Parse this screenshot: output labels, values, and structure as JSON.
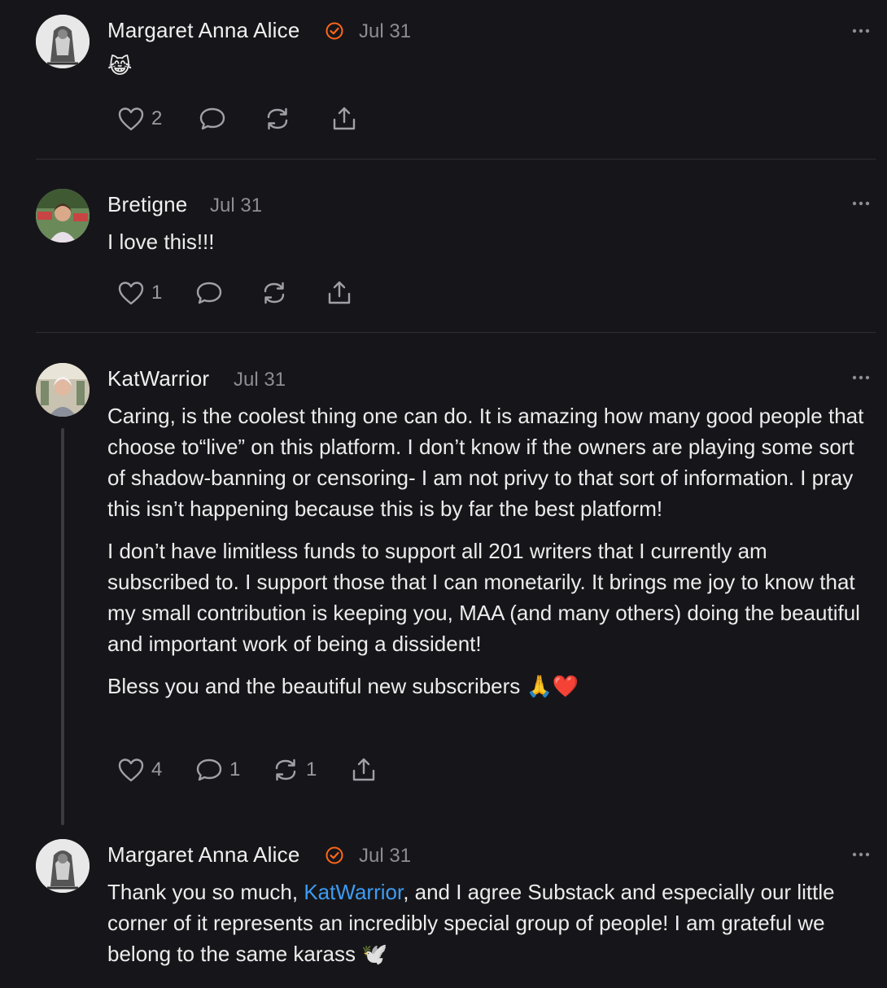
{
  "comments": [
    {
      "author": "Margaret Anna Alice",
      "verified": true,
      "date": "Jul 31",
      "text": "😹",
      "likes": "2",
      "replies": "",
      "restacks": ""
    },
    {
      "author": "Bretigne",
      "verified": false,
      "date": "Jul 31",
      "text": "I love this!!!",
      "likes": "1",
      "replies": "",
      "restacks": ""
    },
    {
      "author": "KatWarrior",
      "verified": false,
      "date": "Jul 31",
      "paragraphs": [
        "Caring, is the coolest thing one can do. It is amazing how many good people that choose to“live” on this platform. I don’t know if the owners are playing some sort of shadow-banning or censoring- I am not privy to that sort of information. I pray this isn’t happening because this is by far the best platform!",
        "I don’t have limitless funds to support all 201 writers that I currently am subscribed to. I support those that I can monetarily. It brings me joy to know that my small contribution is keeping you, MAA (and many others) doing the beautiful and important work of being a dissident!",
        "Bless you and the beautiful new subscribers 🙏❤️"
      ],
      "likes": "4",
      "replies": "1",
      "restacks": "1"
    },
    {
      "author": "Margaret Anna Alice",
      "verified": true,
      "date": "Jul 31",
      "text_before": "Thank you so much, ",
      "mention": "KatWarrior",
      "text_after": ", and I agree Substack and especially our little corner of it represents an incredibly special group of people! I am grateful we belong to the same karass 🕊️"
    }
  ],
  "colors": {
    "background": "#16161a",
    "text": "#ececec",
    "muted": "#8d8d92",
    "accent_badge": "#ff6719",
    "mention": "#3e9bf2"
  },
  "icons": [
    "heart-icon",
    "comment-icon",
    "restack-icon",
    "share-icon",
    "more-icon",
    "verified-badge-icon"
  ]
}
